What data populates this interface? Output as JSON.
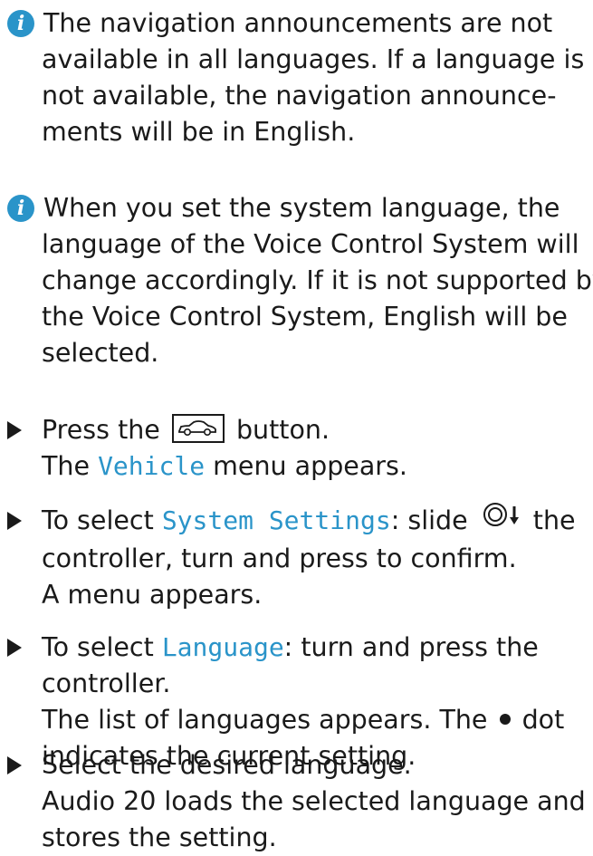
{
  "info_notes": [
    {
      "icon": "info-icon",
      "lines": [
        "The navigation announcements are not",
        "available in all languages. If a language is",
        "not available, the navigation announce-",
        "ments will be in English."
      ]
    },
    {
      "icon": "info-icon",
      "lines": [
        "When you set the system language, the",
        "language of the Voice Control System will",
        "change accordingly. If it is not supported by",
        "the Voice Control System, English will be",
        "selected."
      ]
    }
  ],
  "steps": {
    "s1": {
      "pre": "Press the",
      "post": "button.",
      "result_pre": "The",
      "result_menu": "Vehicle",
      "result_post": "menu appears."
    },
    "s2": {
      "pre": "To select",
      "menu": "System Settings",
      "mid": ": slide",
      "post": "the",
      "line2": "controller, turn and press to confirm.",
      "line3": "A menu appears."
    },
    "s3": {
      "pre": "To select",
      "menu": "Language",
      "post": ": turn and press the",
      "line2": "controller.",
      "line3_pre": "The list of languages appears. The",
      "line3_post": "dot",
      "line4": "indicates the current setting."
    },
    "s4": {
      "line1": "Select the desired language.",
      "line2": "Audio 20 loads the selected language and",
      "line3": "stores the setting."
    }
  },
  "colors": {
    "accent": "#2a94c9",
    "text": "#1a1a1a"
  }
}
